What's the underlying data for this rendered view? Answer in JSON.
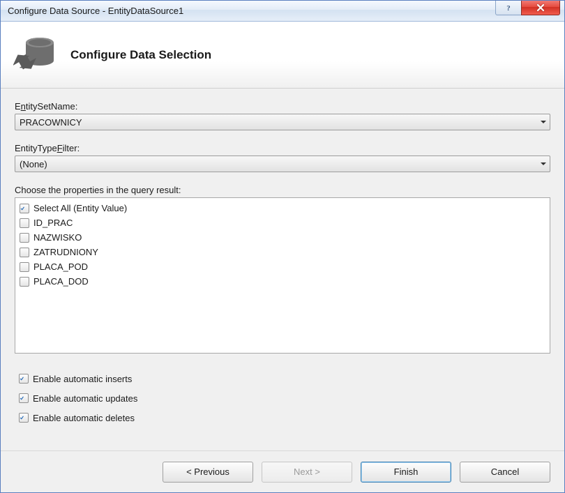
{
  "window": {
    "title": "Configure Data Source - EntityDataSource1"
  },
  "header": {
    "heading": "Configure Data Selection"
  },
  "fields": {
    "entitySetName": {
      "label_pre": "E",
      "label_ul": "n",
      "label_post": "titySetName:",
      "value": "PRACOWNICY"
    },
    "entityTypeFilter": {
      "label_pre": "EntityType",
      "label_ul": "F",
      "label_post": "ilter:",
      "value": "(None)"
    }
  },
  "propsLabel": {
    "pre": "Choose the properties in the query result:",
    "ul": "",
    "post": ""
  },
  "properties": [
    {
      "label": "Select All (Entity Value)",
      "checked": true
    },
    {
      "label": "ID_PRAC",
      "checked": false
    },
    {
      "label": "NAZWISKO",
      "checked": false
    },
    {
      "label": "ZATRUDNIONY",
      "checked": false
    },
    {
      "label": "PLACA_POD",
      "checked": false
    },
    {
      "label": "PLACA_DOD",
      "checked": false
    }
  ],
  "options": {
    "inserts": {
      "label_pre": "Enable automatic ",
      "label_ul": "i",
      "label_post": "nserts",
      "checked": true
    },
    "updates": {
      "label_pre": "Enable automatic ",
      "label_ul": "u",
      "label_post": "pdates",
      "checked": true
    },
    "deletes": {
      "label_pre": "Enable automatic ",
      "label_ul": "d",
      "label_post": "eletes",
      "checked": true
    }
  },
  "footer": {
    "previous": "< Previous",
    "next": "Next >",
    "finish": "Finish",
    "cancel": "Cancel"
  }
}
